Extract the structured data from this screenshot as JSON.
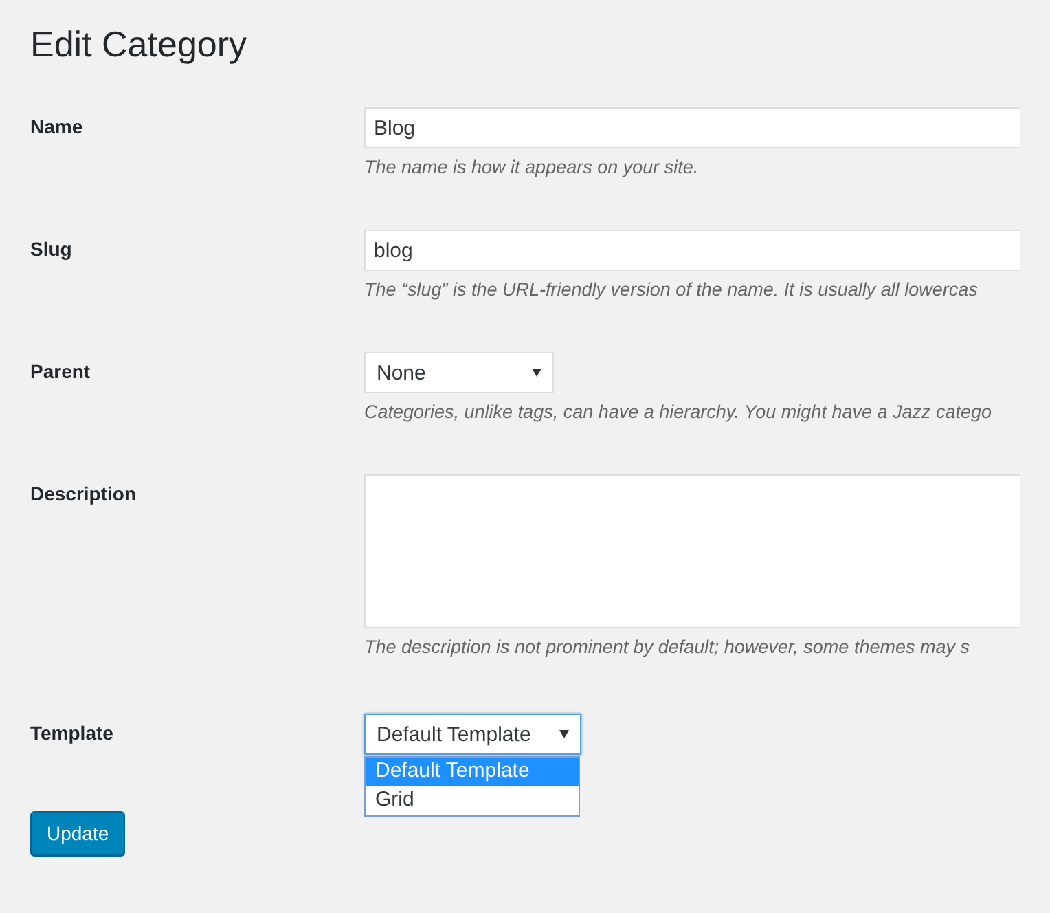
{
  "page": {
    "title": "Edit Category"
  },
  "fields": [
    {
      "label": "Name",
      "kind": "text",
      "value": "Blog",
      "hint": "The name is how it appears on your site."
    },
    {
      "label": "Slug",
      "kind": "text",
      "value": "blog",
      "hint": "The “slug” is the URL-friendly version of the name. It is usually all lowercas"
    },
    {
      "label": "Parent",
      "kind": "select",
      "value": "None",
      "expanded": false,
      "hint": "Categories, unlike tags, can have a hierarchy. You might have a Jazz catego"
    },
    {
      "label": "Description",
      "kind": "textarea",
      "hint": "The description is not prominent by default; however, some themes may s"
    },
    {
      "label": "Template",
      "kind": "select",
      "value": "Default Template",
      "expanded": true,
      "options": [
        {
          "label": "Default Template",
          "selected": true
        },
        {
          "label": "Grid",
          "selected": false
        }
      ]
    }
  ],
  "buttons": [
    {
      "label": "Update"
    }
  ]
}
